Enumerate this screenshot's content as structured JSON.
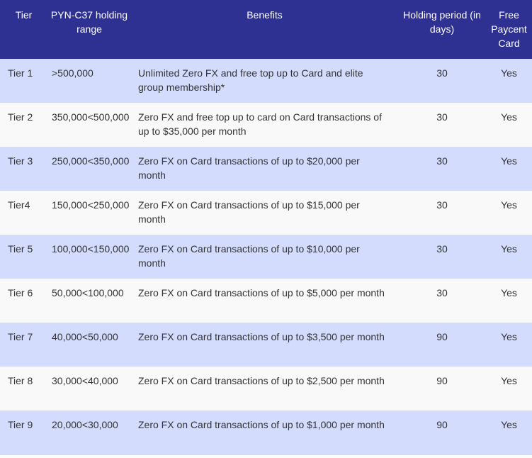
{
  "table": {
    "headers": {
      "tier": "Tier",
      "range": "PYN-C37 holding range",
      "benefits": "Benefits",
      "period": "Holding period (in days)",
      "card": "Free Paycent Card"
    },
    "rows": [
      {
        "tier": "Tier 1",
        "range": ">500,000",
        "benefits": "Unlimited Zero FX and free top up to Card and elite group membership*",
        "period": "30",
        "card": "Yes"
      },
      {
        "tier": "Tier 2",
        "range": "350,000<500,000",
        "benefits": "Zero FX and free top up to card on Card transactions of up to $35,000 per month",
        "period": "30",
        "card": "Yes"
      },
      {
        "tier": "Tier 3",
        "range": "250,000<350,000",
        "benefits": "Zero FX on Card transactions of up to $20,000 per month",
        "period": "30",
        "card": "Yes"
      },
      {
        "tier": "Tier4",
        "range": "150,000<250,000",
        "benefits": "Zero FX on Card transactions of up to $15,000 per month",
        "period": "30",
        "card": "Yes"
      },
      {
        "tier": "Tier 5",
        "range": "100,000<150,000",
        "benefits": "Zero FX on Card transactions of up to $10,000 per month",
        "period": "30",
        "card": "Yes"
      },
      {
        "tier": "Tier 6",
        "range": "50,000<100,000",
        "benefits": "Zero FX on Card transactions of up to $5,000 per month",
        "period": "30",
        "card": "Yes"
      },
      {
        "tier": "Tier 7",
        "range": "40,000<50,000",
        "benefits": "Zero FX on Card transactions of up to $3,500 per month",
        "period": "90",
        "card": "Yes"
      },
      {
        "tier": "Tier 8",
        "range": "30,000<40,000",
        "benefits": "Zero FX on Card transactions of up to $2,500 per month",
        "period": "90",
        "card": "Yes"
      },
      {
        "tier": "Tier 9",
        "range": "20,000<30,000",
        "benefits": "Zero FX on Card transactions of up to $1,000 per month",
        "period": "90",
        "card": "Yes"
      }
    ]
  },
  "colors": {
    "header_bg": "#2e3192",
    "row_odd_bg": "#d3dcfd",
    "row_even_bg": "#f9f9f9",
    "text": "#333333"
  }
}
